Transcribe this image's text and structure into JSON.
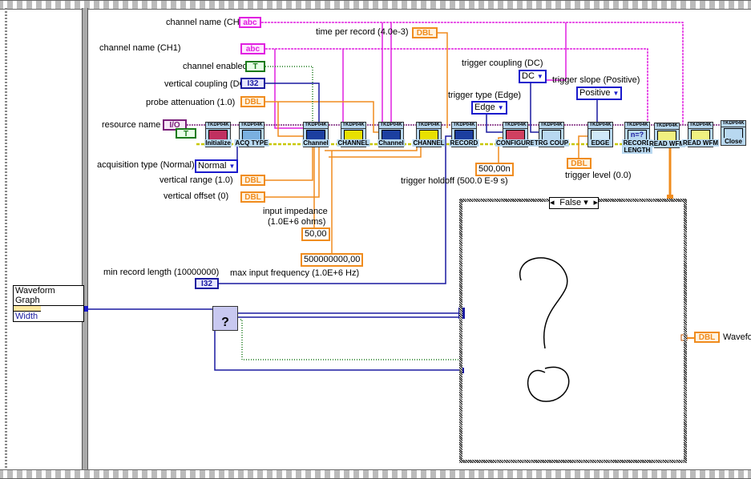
{
  "controls": {
    "channel_name_ch2": {
      "label": "channel name (CH2)",
      "type": "abc"
    },
    "time_per_record": {
      "label": "time per record (4.0e-3)",
      "type": "DBL"
    },
    "channel_name_ch1": {
      "label": "channel name (CH1)",
      "type": "abc"
    },
    "channel_enabled": {
      "label": "channel enabled",
      "type": "T"
    },
    "vertical_coupling": {
      "label": "vertical coupling (DC)",
      "type": "I32"
    },
    "probe_attenuation": {
      "label": "probe attenuation (1.0)",
      "type": "DBL"
    },
    "resource_name": {
      "label": "resource name",
      "type": "I/O",
      "bool": "T"
    },
    "acquisition_type": {
      "label": "acquisition type (Normal)",
      "value": "Normal"
    },
    "vertical_range": {
      "label": "vertical range (1.0)",
      "type": "DBL"
    },
    "vertical_offset": {
      "label": "vertical offset (0)",
      "type": "DBL"
    },
    "input_impedance": {
      "label1": "input impedance",
      "label2": "(1.0E+6 ohms)",
      "value": "50,00"
    },
    "max_input_frequency": {
      "label": "max input frequency (1.0E+6 Hz)",
      "value": "500000000,00"
    },
    "min_record_length": {
      "label": "min record length (10000000)",
      "type": "I32"
    },
    "trigger_coupling": {
      "label": "trigger coupling (DC)",
      "value": "DC"
    },
    "trigger_type": {
      "label": "trigger type (Edge)",
      "value": "Edge"
    },
    "trigger_slope": {
      "label": "trigger slope (Positive)",
      "value": "Positive"
    },
    "trigger_holdoff": {
      "label": "trigger holdoff (500.0 E-9 s)",
      "value": "500,00n"
    },
    "trigger_level": {
      "label": "trigger level (0.0)",
      "type": "DBL"
    }
  },
  "nodes": [
    {
      "title": "TKDP04K",
      "caption": "Initialize"
    },
    {
      "title": "TKDP04K",
      "caption": "ACQ TYPE"
    },
    {
      "title": "TKDP04K",
      "caption": "Channel"
    },
    {
      "title": "TKDP04K",
      "caption": "CHANNEL"
    },
    {
      "title": "TKDP04K",
      "caption": "Channel"
    },
    {
      "title": "TKDP04K",
      "caption": "CHANNEL"
    },
    {
      "title": "TKDP04K",
      "caption": "RECORD"
    },
    {
      "title": "TKDP04K",
      "caption": "CONFIGURE"
    },
    {
      "title": "TKDP04K",
      "caption": "TRG COUP"
    },
    {
      "title": "TKDP04K",
      "caption": "EDGE"
    },
    {
      "title": "TKDP04K",
      "caption": "RECORD LENGTH"
    },
    {
      "title": "TKDP04K",
      "caption": "READ WFM"
    },
    {
      "title": "TKDP04K",
      "caption": "READ WFM"
    },
    {
      "title": "TKDP04K",
      "caption": "Close"
    }
  ],
  "property_node": {
    "title": "Waveform Graph",
    "property": "Width"
  },
  "case_structure": {
    "selector": "False"
  },
  "output": {
    "type": "DBL",
    "label": "Waveform"
  },
  "colors": {
    "string": "#e020e0",
    "dbl": "#f08c1e",
    "i32": "#1a1aa0",
    "bool": "#1a7a1a",
    "error": "#c8c800"
  }
}
